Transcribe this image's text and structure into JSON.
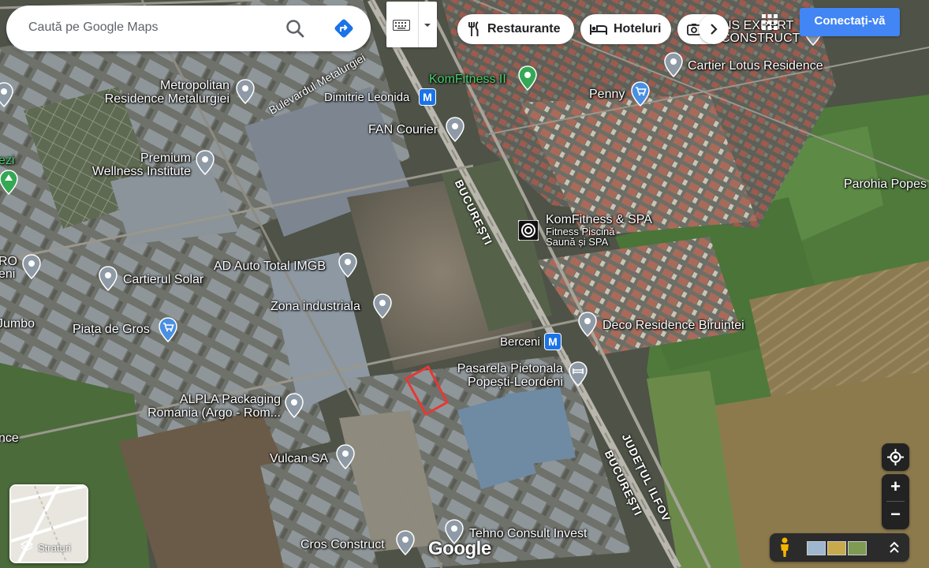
{
  "search": {
    "placeholder": "Caută pe Google Maps"
  },
  "chips": [
    {
      "label": "Restaurante",
      "icon": "fork-knife-icon"
    },
    {
      "label": "Hoteluri",
      "icon": "bed-icon"
    },
    {
      "icon": "camera-icon"
    }
  ],
  "sign_in": "Conectați-vă",
  "layers": {
    "label": "Straturi"
  },
  "google_logo": "Google",
  "roads": {
    "metalurgiei": "Bulevardul Metalurgiei",
    "bucuresti": "BUCUREȘTI",
    "bucuresti2": "BUCUREȘTI",
    "judetul_ilfov": "JUDEȚUL ILFOV"
  },
  "places": {
    "metropolitan_l1": "Metropolitan",
    "metropolitan_l2": "Residence Metalurgiei",
    "komfitness2": "KomFitness II",
    "dimitrie_leonida": "Dimitrie Leonida",
    "fan_courier": "FAN Courier",
    "cartier_lotus": "Cartier Lotus Residence",
    "penny": "Penny",
    "premium_l1": "Premium",
    "premium_l2": "Wellness Institute",
    "parohia": "Parohia Popes",
    "komfitness_spa": "KomFitness & SPA",
    "komfitness_sub1": "Fitness Piscină",
    "komfitness_sub2": "Saună și SPA",
    "ad_auto": "AD Auto Total IMGB",
    "cartierul_solar": "Cartierul Solar",
    "zona_industriala": "Zona industriala",
    "deco_residence": "Deco Residence Biruintei",
    "piata_de_gros": "Piața de Gros",
    "berceni": "Berceni",
    "pasarela_l1": "Pasarela Pietonala",
    "pasarela_l2": "Popești-Leordeni",
    "alpla_l1": "ALPLA Packaging",
    "alpla_l2": "Romania (Argo - Rom...",
    "vulcan": "Vulcan SA",
    "tehno_consult": "Tehno Consult Invest",
    "cros_construct": "Cros Construct",
    "edge_ro": "RO",
    "edge_eni": "eni",
    "edge_jumbo": "Jumbo",
    "edge_ezi": "ezi",
    "edge_nce": "nce",
    "edge_ns_expert": "NS EXPERT",
    "edge_construct": "CONSTRUCT"
  },
  "metro_letter": "M",
  "colors": {
    "pin_gray": "#8e9aa6",
    "pin_green": "#34a853",
    "pin_blue": "#4a90e2",
    "metro_blue": "#1a73e8",
    "signin_blue": "#4285f4",
    "highlight_red": "#e53935"
  }
}
